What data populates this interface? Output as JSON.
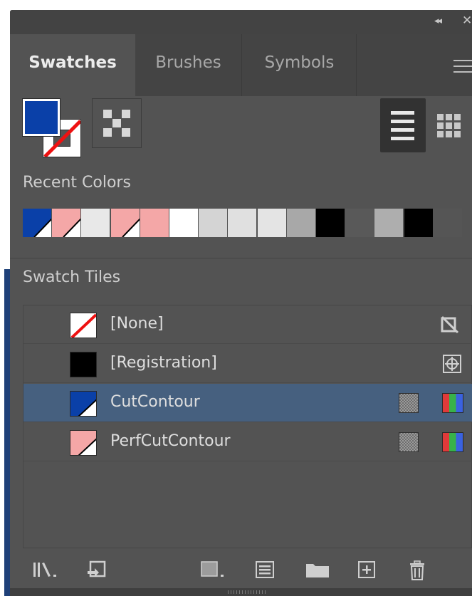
{
  "panel": {
    "title_controls": {
      "collapse_icon": "double-chevron-left-icon",
      "close_icon": "close-icon"
    },
    "tabs": [
      {
        "label": "Swatches",
        "active": true
      },
      {
        "label": "Brushes",
        "active": false
      },
      {
        "label": "Symbols",
        "active": false
      }
    ],
    "menu_icon": "hamburger-menu-icon"
  },
  "fill_stroke": {
    "fill_color": "#0A40A8",
    "stroke": "none"
  },
  "view_modes": {
    "list_view": "active",
    "grid_view": "inactive"
  },
  "recent_colors": {
    "label": "Recent Colors",
    "swatches": [
      {
        "color": "#0A40A8",
        "overprint": true
      },
      {
        "color": "#F4A7A7",
        "overprint": true
      },
      {
        "color": "#E8E8E8",
        "overprint": false
      },
      {
        "color": "#F4A7A7",
        "overprint": true
      },
      {
        "color": "#F4A7A7",
        "overprint": false
      },
      {
        "color": "#FFFFFF",
        "overprint": false
      },
      {
        "color": "#D4D4D4",
        "overprint": false
      },
      {
        "color": "#E0E0E0",
        "overprint": false
      },
      {
        "color": "#E4E4E4",
        "overprint": false
      },
      {
        "color": "#A8A8A8",
        "overprint": false
      },
      {
        "color": "#000000",
        "overprint": false
      },
      {
        "color": "#595959",
        "overprint": false
      },
      {
        "color": "#AEAEAE",
        "overprint": false
      },
      {
        "color": "#000000",
        "overprint": false
      },
      {
        "color": "#555555",
        "overprint": false
      }
    ]
  },
  "swatch_tiles": {
    "label": "Swatch Tiles",
    "items": [
      {
        "label": "[None]",
        "chip": "none",
        "selected": false,
        "icons": [
          "no-edit-icon"
        ]
      },
      {
        "label": "[Registration]",
        "chip": "#000000",
        "selected": false,
        "icons": [
          "registration-target-icon"
        ]
      },
      {
        "label": "CutContour",
        "chip": "#0A40A8",
        "selected": true,
        "icons": [
          "global-color-icon",
          "spot-color-icon"
        ]
      },
      {
        "label": "PerfCutContour",
        "chip": "#F4A7A7",
        "selected": false,
        "icons": [
          "global-color-icon",
          "spot-color-icon"
        ]
      }
    ]
  },
  "bottom_toolbar": [
    "swatch-libraries-menu-icon",
    "place-swatches-icon",
    "show-swatch-kinds-menu-icon",
    "swatch-options-icon",
    "new-color-group-icon",
    "new-swatch-icon",
    "delete-swatch-icon"
  ]
}
